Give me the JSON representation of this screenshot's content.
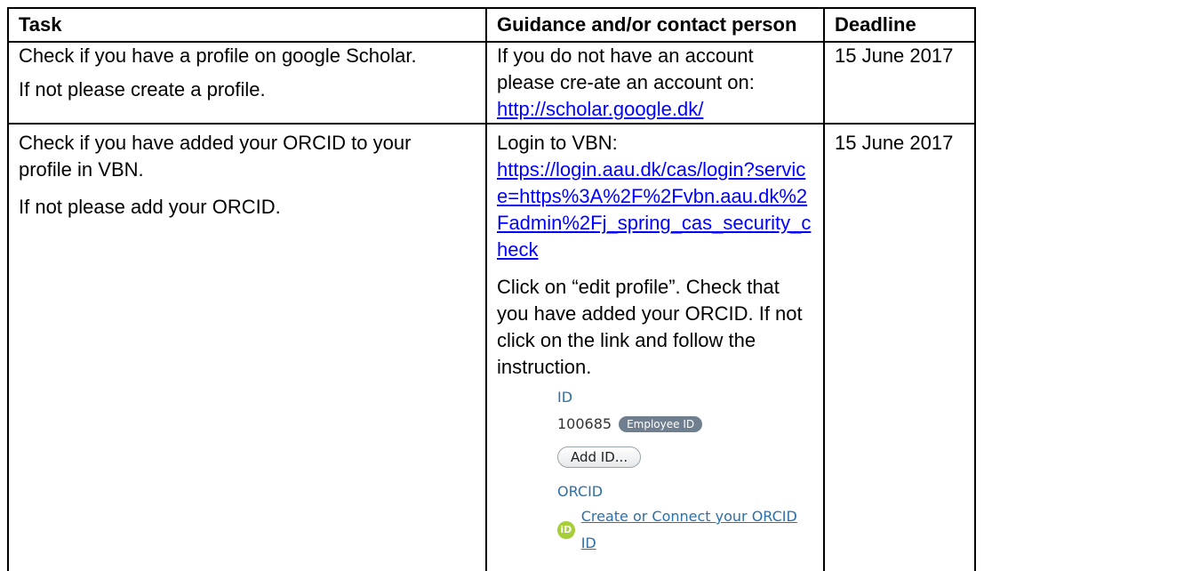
{
  "table": {
    "headers": {
      "task": "Task",
      "guidance": "Guidance and/or contact person",
      "deadline": "Deadline"
    },
    "rows": [
      {
        "task": [
          "Check if you have a profile on google Scholar.",
          "If not please create a profile."
        ],
        "guidance_text": "If you do not have an account please cre-ate an account on: ",
        "guidance_link": "http://scholar.google.dk/",
        "deadline": "15 June 2017"
      },
      {
        "task": [
          "Check if you have added your ORCID to your profile in VBN.",
          "If not please add your ORCID."
        ],
        "guidance_intro": "Login to VBN:",
        "guidance_link": "https://login.aau.dk/cas/login?service=https%3A%2F%2Fvbn.aau.dk%2Fadmin%2Fj_spring_cas_security_check",
        "guidance_text": "Click on “edit profile”. Check that you have added your ORCID. If not click on the link and follow the instruction.",
        "deadline": "15 June 2017"
      }
    ]
  },
  "vbn_screenshot": {
    "id_label": "ID",
    "id_value": "100685",
    "id_badge": "Employee ID",
    "add_button": "Add ID...",
    "orcid_label": "ORCID",
    "orcid_icon_text": "iD",
    "orcid_link": "Create or Connect your ORCID ID",
    "colors": {
      "label": "#2d6fa8",
      "badge": "#6f7f8f",
      "orcid_green": "#a6ce39"
    }
  }
}
